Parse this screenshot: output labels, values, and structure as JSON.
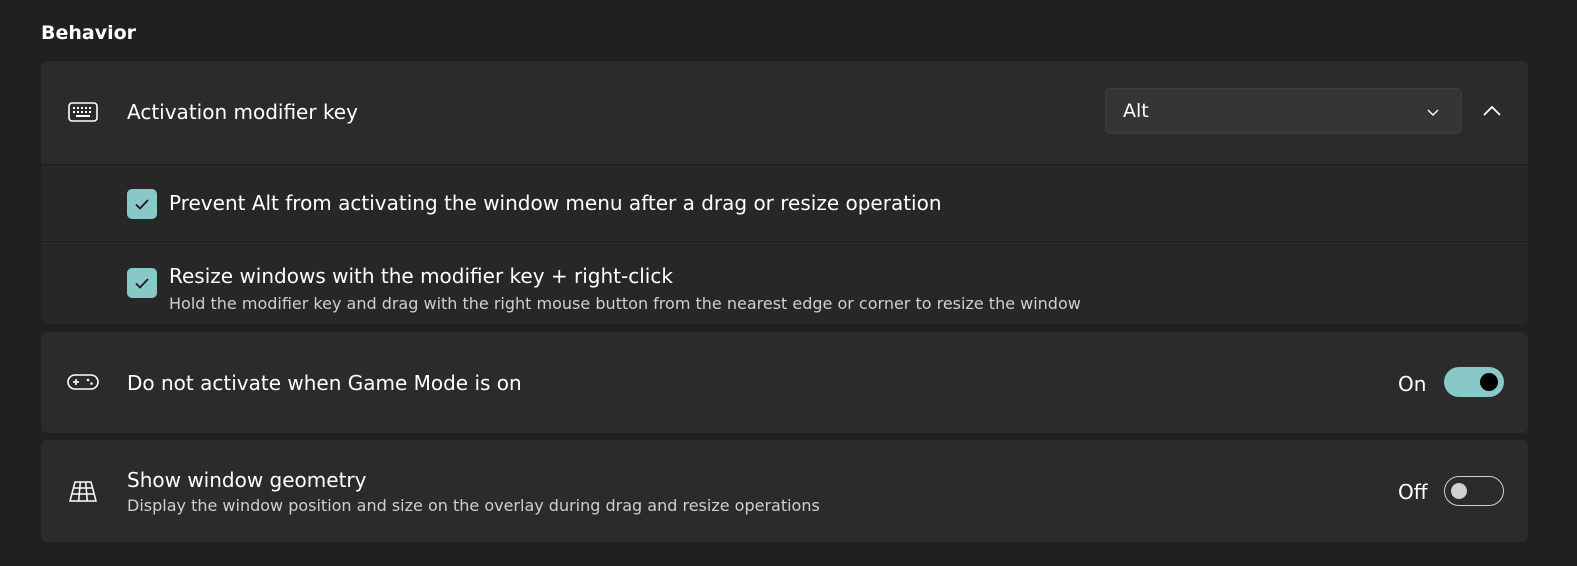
{
  "section": {
    "title": "Behavior"
  },
  "activation": {
    "label": "Activation modifier key",
    "icon": "keyboard-icon",
    "dropdown_value": "Alt",
    "expanded": true
  },
  "prevent_alt": {
    "label": "Prevent Alt from activating the window menu after a drag or resize operation",
    "checked": true
  },
  "resize_right_click": {
    "label": "Resize windows with the modifier key + right-click",
    "description": "Hold the modifier key and drag with the right mouse button from the nearest edge or corner to resize the window",
    "checked": true
  },
  "game_mode": {
    "label": "Do not activate when Game Mode is on",
    "icon": "gamepad-icon",
    "state_text": "On",
    "enabled": true
  },
  "geometry": {
    "label": "Show window geometry",
    "description": "Display the window position and size on the overlay during drag and resize operations",
    "icon": "grid-perspective-icon",
    "state_text": "Off",
    "enabled": false
  },
  "colors": {
    "background": "#202020",
    "card": "#2b2b2b",
    "accent": "#88c9c7"
  }
}
